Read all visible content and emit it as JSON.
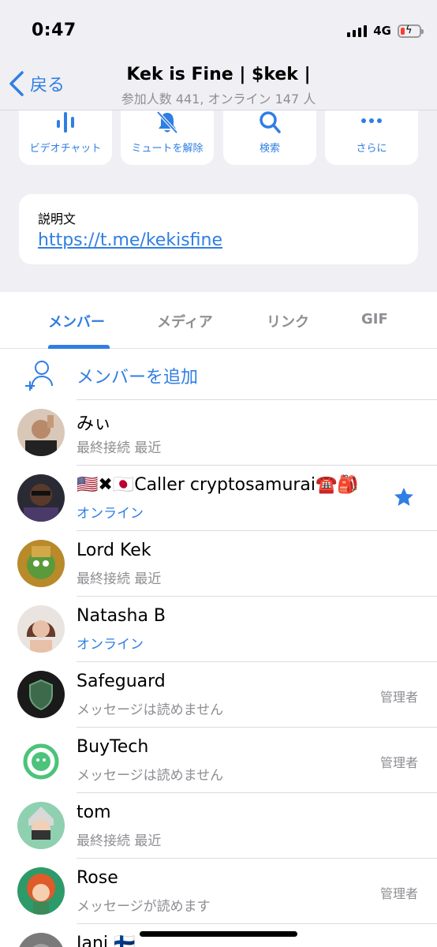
{
  "status_bar": {
    "time": "0:47",
    "network": "4G"
  },
  "nav": {
    "back_label": "戻る",
    "title": "Kek is Fine | $kek |",
    "subtitle": "参加人数 441, オンライン 147 人"
  },
  "actions": [
    {
      "label": "ビデオチャット",
      "icon": "voice-waveform-icon"
    },
    {
      "label": "ミュートを解除",
      "icon": "bell-slash-icon"
    },
    {
      "label": "検索",
      "icon": "search-icon"
    },
    {
      "label": "さらに",
      "icon": "more-dots-icon"
    }
  ],
  "description": {
    "label": "説明文",
    "link": "https://t.me/kekisfine"
  },
  "tabs": [
    {
      "label": "メンバー",
      "active": true
    },
    {
      "label": "メディア",
      "active": false
    },
    {
      "label": "リンク",
      "active": false
    },
    {
      "label": "GIF",
      "active": false
    }
  ],
  "add_member_label": "メンバーを追加",
  "members": [
    {
      "name": "みぃ",
      "status": "最終接続 最近",
      "online": false,
      "role": ""
    },
    {
      "name": "🇺🇸✖🇯🇵Caller cryptosamurai☎️🎒",
      "status": "オンライン",
      "online": true,
      "role": "",
      "starred": true
    },
    {
      "name": "Lord Kek",
      "status": "最終接続 最近",
      "online": false,
      "role": ""
    },
    {
      "name": "Natasha B",
      "status": "オンライン",
      "online": true,
      "role": ""
    },
    {
      "name": "Safeguard",
      "status": "メッセージは読めません",
      "online": false,
      "role": "管理者"
    },
    {
      "name": "BuyTech",
      "status": "メッセージは読めません",
      "online": false,
      "role": "管理者"
    },
    {
      "name": "tom",
      "status": "最終接続 最近",
      "online": false,
      "role": ""
    },
    {
      "name": "Rose",
      "status": "メッセージが読めます",
      "online": false,
      "role": "管理者"
    },
    {
      "name": "Jani 🇫🇮",
      "status": "",
      "online": false,
      "role": ""
    }
  ],
  "colors": {
    "accent": "#2f7ee3",
    "secondary_text": "#8e8e93",
    "grouped_bg": "#efeff4"
  }
}
